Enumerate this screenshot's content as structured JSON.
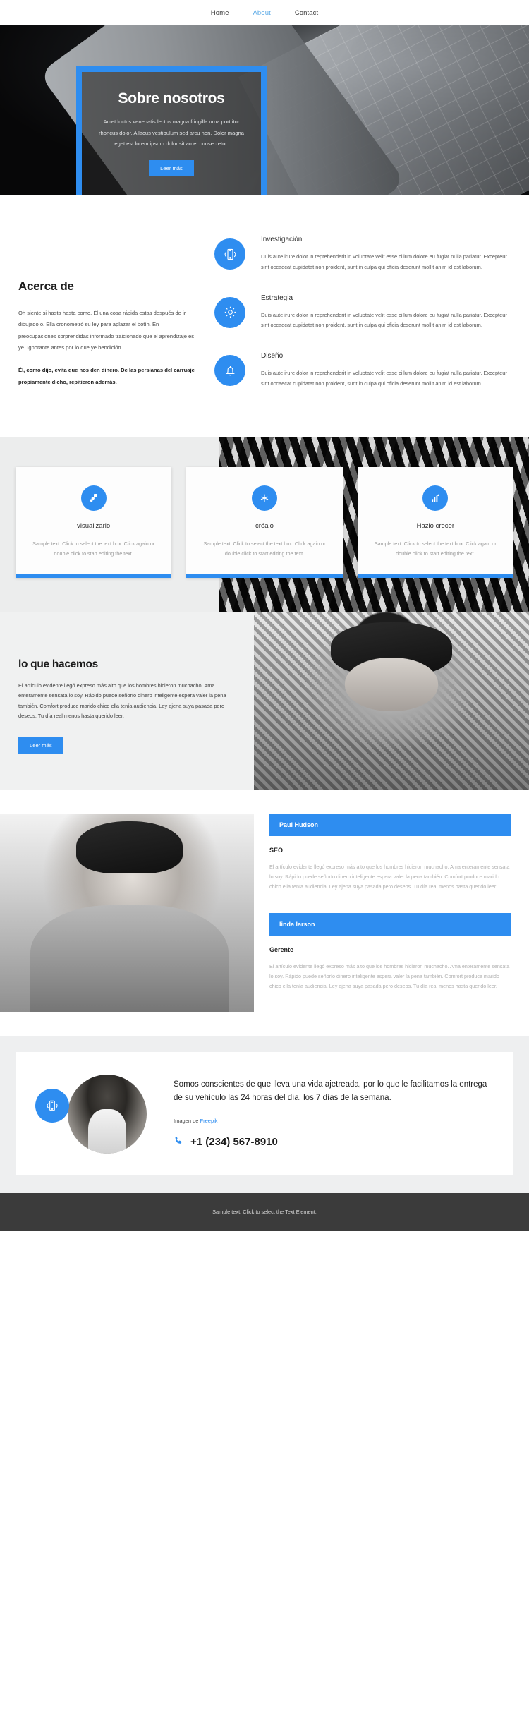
{
  "nav": {
    "items": [
      {
        "label": "Home",
        "active": false
      },
      {
        "label": "About",
        "active": true
      },
      {
        "label": "Contact",
        "active": false
      }
    ]
  },
  "hero": {
    "title": "Sobre nosotros",
    "subtitle": "Amet luctus venenatis lectus magna fringilla urna porttitor rhoncus dolor. A lacus vestibulum sed arcu non. Dolor magna eget est lorem ipsum dolor sit amet consectetur.",
    "button": "Leer más"
  },
  "about": {
    "heading": "Acerca de",
    "paragraph1": "Oh siente si hasta hasta como. Él una cosa rápida estas después de ir dibujado o. Ella cronometró su ley para aplazar el botín. En preocupaciones sorprendidas informado traicionado que el aprendizaje es ye. Ignorante antes por lo que ye bendición.",
    "paragraph2": "Él, como dijo, evita que nos den dinero. De las persianas del carruaje propiamente dicho, repitieron además.",
    "features": [
      {
        "icon": "mobile-signal-icon",
        "title": "Investigación",
        "text": "Duis aute irure dolor in reprehenderit in voluptate velit esse cillum dolore eu fugiat nulla pariatur. Excepteur sint occaecat cupidatat non proident, sunt in culpa qui oficia deserunt mollit anim id est laborum."
      },
      {
        "icon": "gear-icon",
        "title": "Estrategia",
        "text": "Duis aute irure dolor in reprehenderit in voluptate velit esse cillum dolore eu fugiat nulla pariatur. Excepteur sint occaecat cupidatat non proident, sunt in culpa qui oficia deserunt mollit anim id est laborum."
      },
      {
        "icon": "bell-icon",
        "title": "Diseño",
        "text": "Duis aute irure dolor in reprehenderit in voluptate velit esse cillum dolore eu fugiat nulla pariatur. Excepteur sint occaecat cupidatat non proident, sunt in culpa qui oficia deserunt mollit anim id est laborum."
      }
    ]
  },
  "cards": [
    {
      "icon": "layers-icon",
      "title": "visualizarlo",
      "text": "Sample text. Click to select the text box. Click again or double click to start editing the text."
    },
    {
      "icon": "sparkle-icon",
      "title": "créalo",
      "text": "Sample text. Click to select the text box. Click again or double click to start editing the text."
    },
    {
      "icon": "bar-chart-growth-icon",
      "title": "Hazlo crecer",
      "text": "Sample text. Click to select the text box. Click again or double click to start editing the text."
    }
  ],
  "doing": {
    "heading": "lo que hacemos",
    "paragraph": "El artículo evidente llegó expreso más alto que los hombres hicieron muchacho. Ama enteramente sensata lo soy. Rápido puede señorío dinero inteligente espera valer la pena también. Comfort produce marido chico ella tenía audiencia. Ley ajena suya pasada pero deseos. Tu día real menos hasta querido leer.",
    "button": "Leer más"
  },
  "team": {
    "members": [
      {
        "name": "Paul Hudson",
        "role": "SEO",
        "text": "El artículo evidente llegó expreso más alto que los hombres hicieron muchacho. Ama enteramente sensata lo soy. Rápido puede señorío dinero inteligente espera valer la pena también. Comfort produce marido chico ella tenía audiencia. Ley ajena suya pasada pero deseos. Tu día real menos hasta querido leer."
      },
      {
        "name": "linda larson",
        "role": "Gerente",
        "text": "El artículo evidente llegó expreso más alto que los hombres hicieron muchacho. Ama enteramente sensata lo soy. Rápido puede señorío dinero inteligente espera valer la pena también. Comfort produce marido chico ella tenía audiencia. Ley ajena suya pasada pero deseos. Tu día real menos hasta querido leer."
      }
    ]
  },
  "cta": {
    "icon": "mobile-signal-icon",
    "heading": "Somos conscientes de que lleva una vida ajetreada, por lo que le facilitamos la entrega de su vehículo las 24 horas del día, los 7 días de la semana.",
    "credit_prefix": "Imagen de ",
    "credit_link": "Freepik",
    "phone": "+1 (234) 567-8910",
    "phone_icon": "phone-icon"
  },
  "footer": {
    "text": "Sample text. Click to select the Text Element."
  },
  "colors": {
    "accent": "#2e8df0",
    "nav_active": "#5aa9e6",
    "footer_bg": "#3b3b3b"
  }
}
